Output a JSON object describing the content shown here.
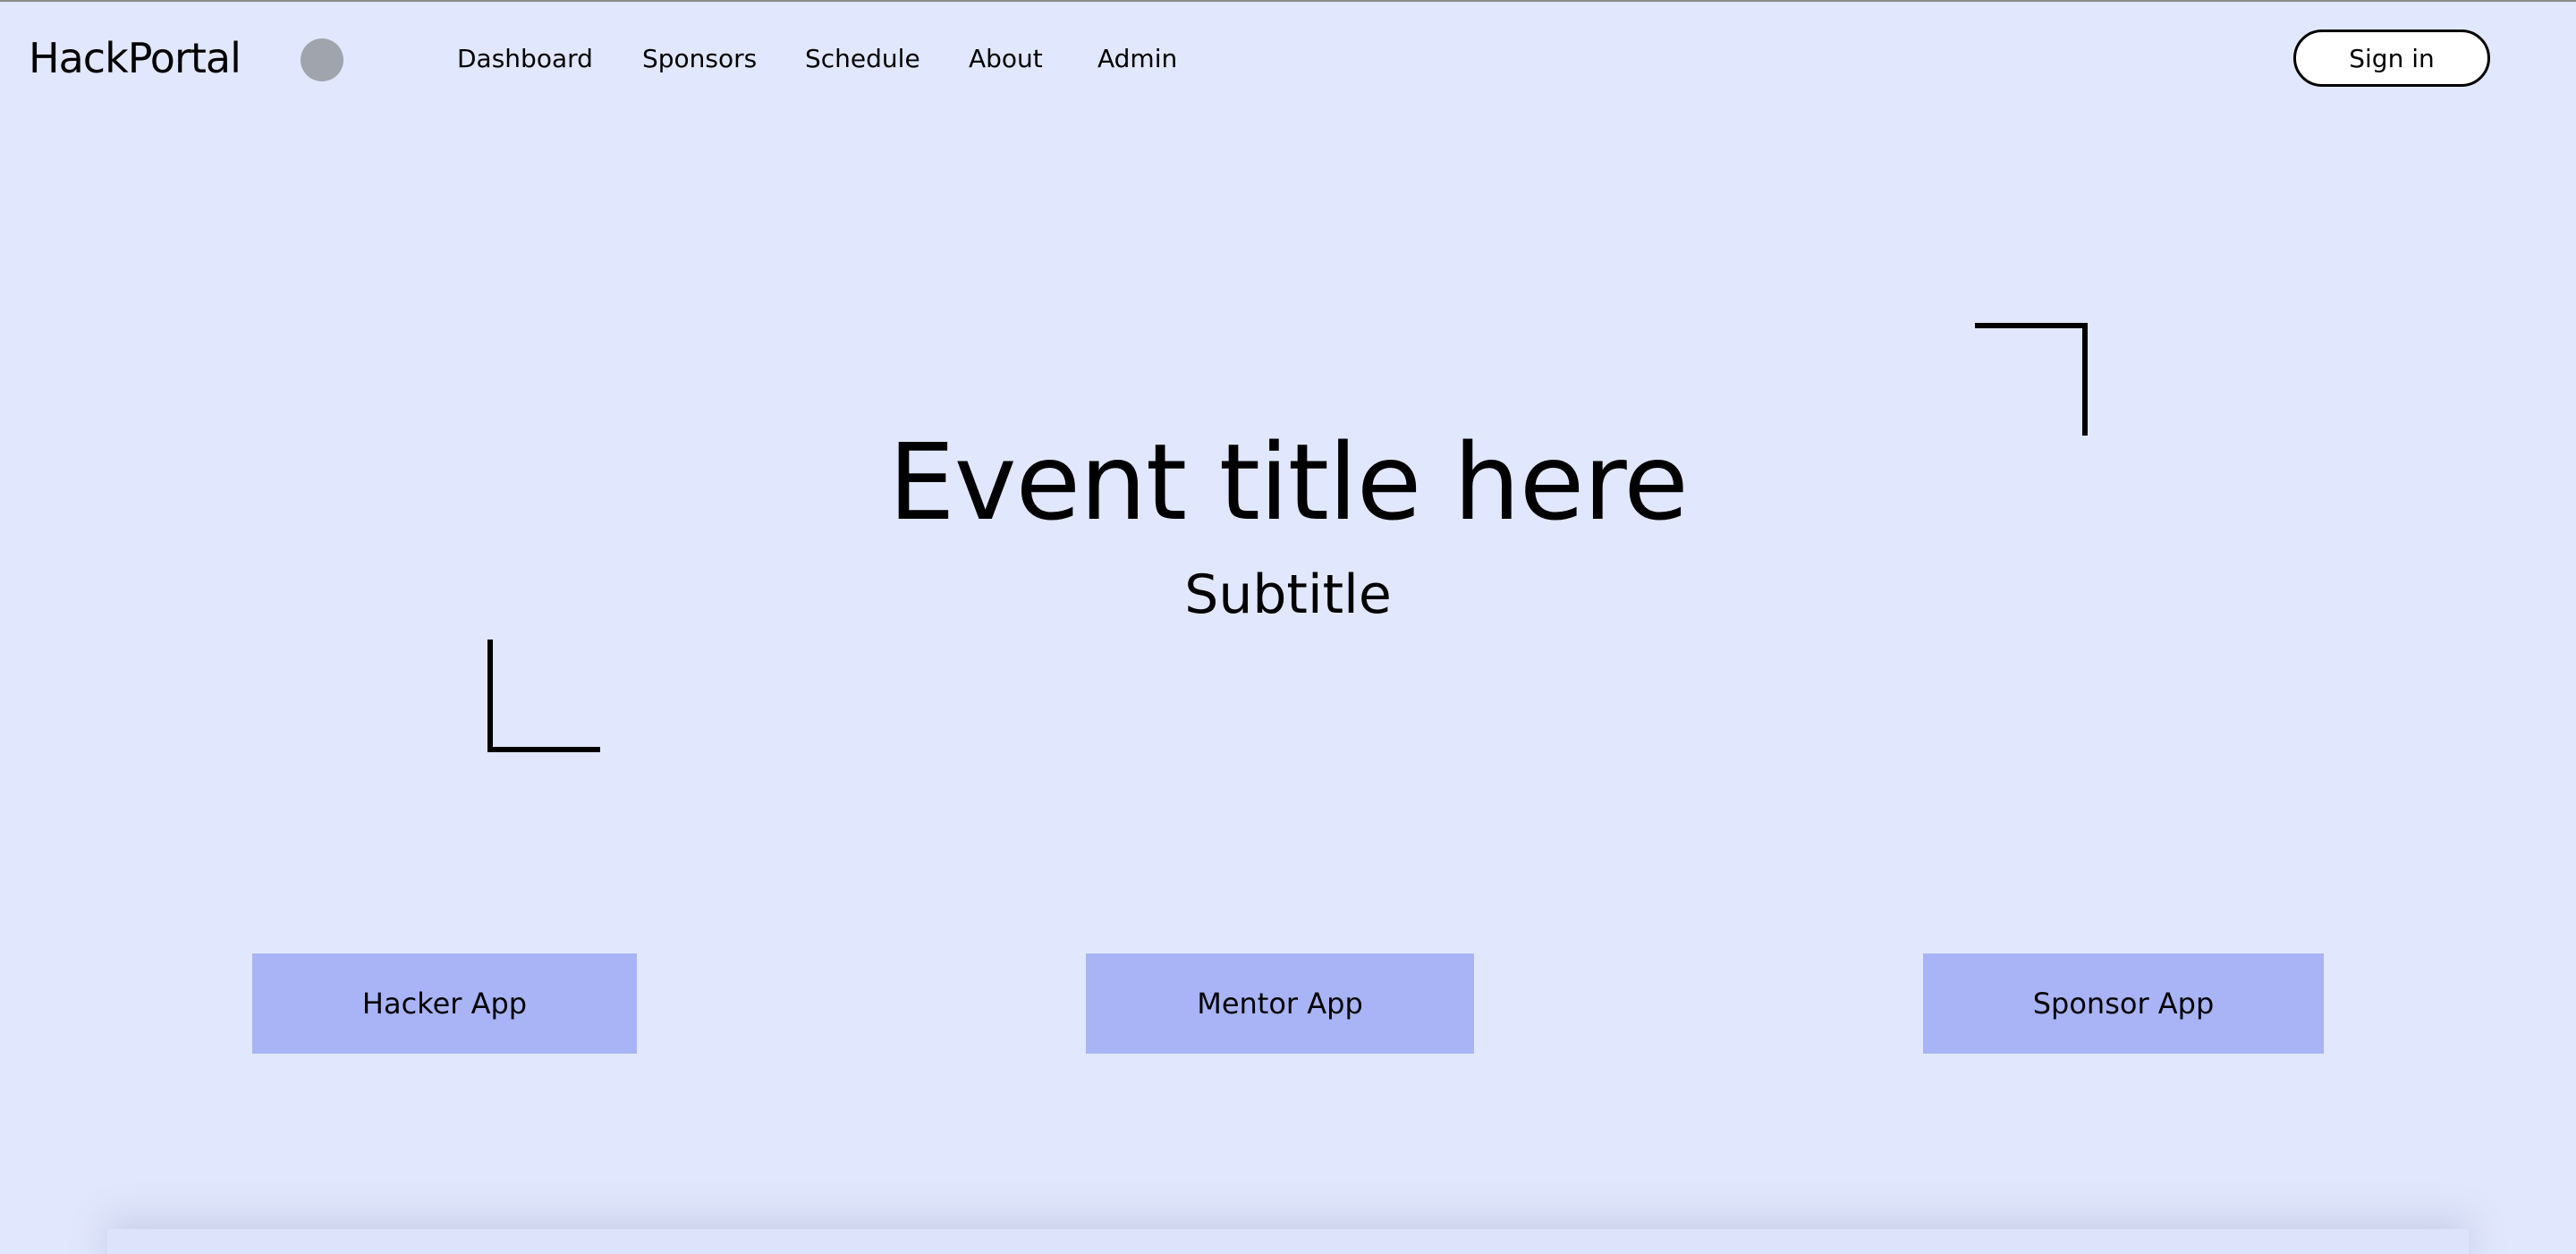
{
  "header": {
    "logo_text": "HackPortal",
    "nav": [
      {
        "label": "Dashboard"
      },
      {
        "label": "Sponsors"
      },
      {
        "label": "Schedule"
      },
      {
        "label": "About"
      },
      {
        "label": "Admin"
      }
    ],
    "signin_label": "Sign in"
  },
  "hero": {
    "title": "Event title here",
    "subtitle": "Subtitle"
  },
  "apps": [
    {
      "label": "Hacker App"
    },
    {
      "label": "Mentor App"
    },
    {
      "label": "Sponsor App"
    }
  ],
  "colors": {
    "background": "#e1e7fc",
    "app_button": "#a8b4f5",
    "avatar": "#9fa4ad",
    "signin_bg": "#ffffff",
    "text": "#000000"
  }
}
